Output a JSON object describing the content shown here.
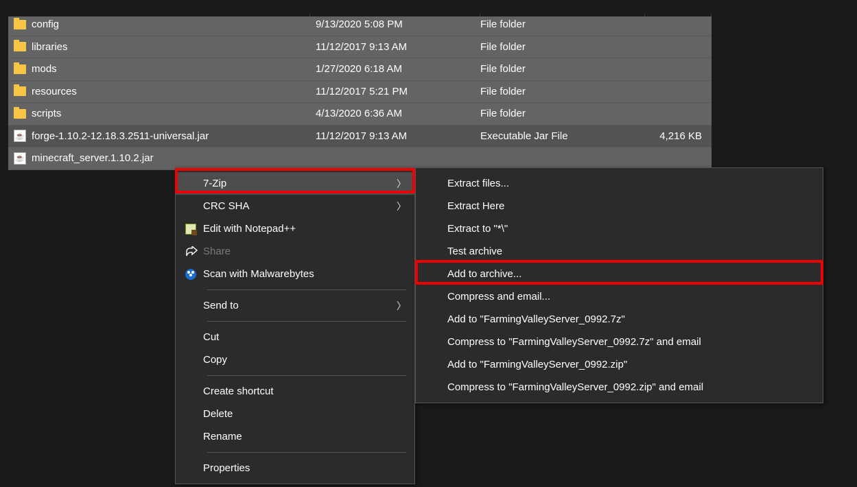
{
  "files": [
    {
      "icon": "folder",
      "name": "config",
      "date": "9/13/2020 5:08 PM",
      "type": "File folder",
      "size": ""
    },
    {
      "icon": "folder",
      "name": "libraries",
      "date": "11/12/2017 9:13 AM",
      "type": "File folder",
      "size": ""
    },
    {
      "icon": "folder",
      "name": "mods",
      "date": "1/27/2020 6:18 AM",
      "type": "File folder",
      "size": ""
    },
    {
      "icon": "folder",
      "name": "resources",
      "date": "11/12/2017 5:21 PM",
      "type": "File folder",
      "size": ""
    },
    {
      "icon": "folder",
      "name": "scripts",
      "date": "4/13/2020 6:36 AM",
      "type": "File folder",
      "size": ""
    },
    {
      "icon": "jar",
      "name": "forge-1.10.2-12.18.3.2511-universal.jar",
      "date": "11/12/2017 9:13 AM",
      "type": "Executable Jar File",
      "size": "4,216 KB"
    },
    {
      "icon": "jar",
      "name": "minecraft_server.1.10.2.jar",
      "date": "",
      "type": "",
      "size": ""
    }
  ],
  "context_menu": {
    "sevenzip": "7-Zip",
    "crc_sha": "CRC SHA",
    "edit_npp": "Edit with Notepad++",
    "share": "Share",
    "scan_mwb": "Scan with Malwarebytes",
    "send_to": "Send to",
    "cut": "Cut",
    "copy": "Copy",
    "create_shortcut": "Create shortcut",
    "delete": "Delete",
    "rename": "Rename",
    "properties": "Properties"
  },
  "sevenzip_menu": {
    "extract_files": "Extract files...",
    "extract_here": "Extract Here",
    "extract_to": "Extract to \"*\\\"",
    "test_archive": "Test archive",
    "add_to_archive": "Add to archive...",
    "compress_email": "Compress and email...",
    "add_to_7z": "Add to \"FarmingValleyServer_0992.7z\"",
    "compress_7z_email": "Compress to \"FarmingValleyServer_0992.7z\" and email",
    "add_to_zip": "Add to \"FarmingValleyServer_0992.zip\"",
    "compress_zip_email": "Compress to \"FarmingValleyServer_0992.zip\" and email"
  },
  "highlight_color": "#eb0202"
}
